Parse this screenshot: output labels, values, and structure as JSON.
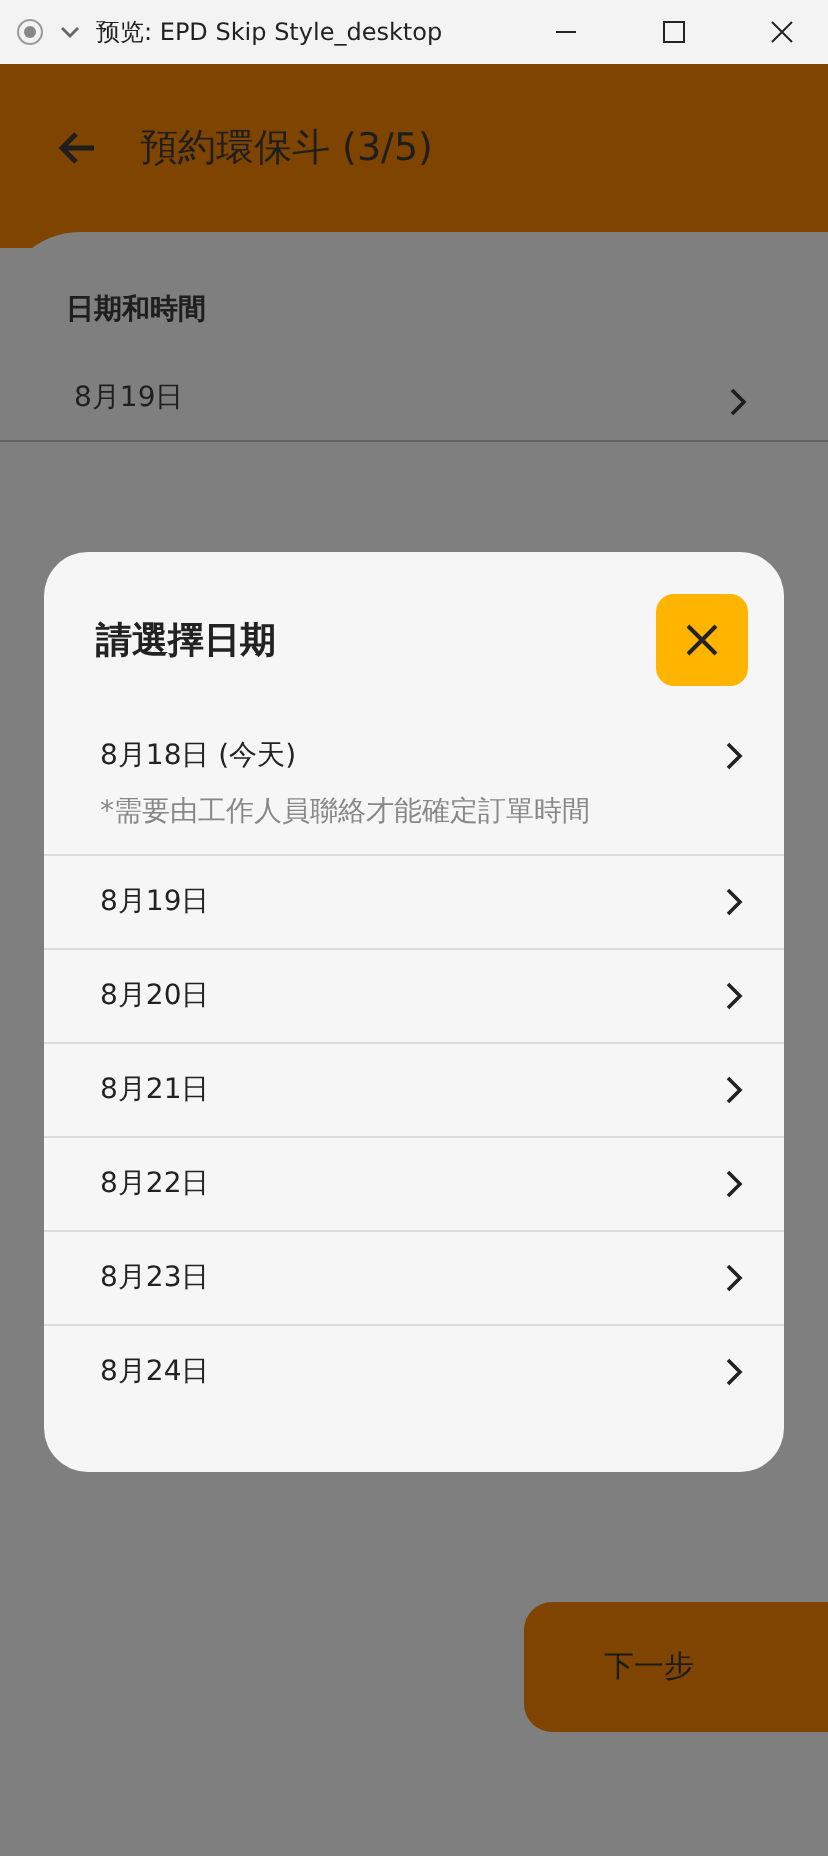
{
  "window": {
    "title": "预览: EPD Skip Style_desktop"
  },
  "header": {
    "title": "預約環保斗 (3/5)"
  },
  "section": {
    "label": "日期和時間",
    "value": "8月19日"
  },
  "dialog": {
    "title": "請選擇日期",
    "dates": [
      {
        "label": "8月18日 (今天)",
        "note": "*需要由工作人員聯絡才能確定訂單時間"
      },
      {
        "label": "8月19日"
      },
      {
        "label": "8月20日"
      },
      {
        "label": "8月21日"
      },
      {
        "label": "8月22日"
      },
      {
        "label": "8月23日"
      },
      {
        "label": "8月24日"
      }
    ]
  },
  "next_button": "下一步"
}
